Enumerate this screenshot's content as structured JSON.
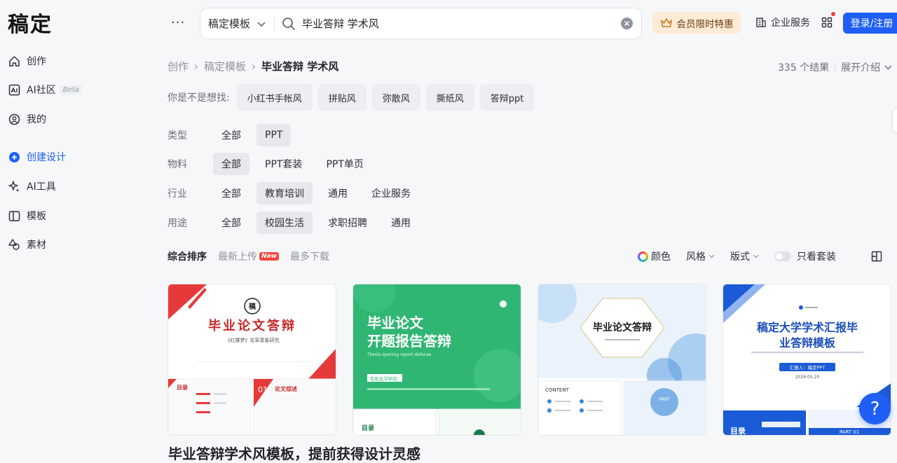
{
  "app": {
    "logo": "稿定"
  },
  "sidebar": {
    "items": [
      {
        "label": "创作",
        "icon": "home-icon"
      },
      {
        "label": "AI社区",
        "icon": "ai-community-icon",
        "badge": "Beta"
      },
      {
        "label": "我的",
        "icon": "user-icon"
      },
      {
        "label": "创建设计",
        "icon": "plus-circle-icon",
        "active": true
      },
      {
        "label": "AI工具",
        "icon": "sparkle-icon"
      },
      {
        "label": "模板",
        "icon": "template-icon"
      },
      {
        "label": "素材",
        "icon": "material-icon"
      }
    ]
  },
  "header": {
    "more": "···",
    "search": {
      "scope": "稿定模板",
      "query": "毕业答辩 学术风"
    },
    "vip": "会员限时特惠",
    "enterprise": "企业服务",
    "login": "登录/注册"
  },
  "breadcrumb": {
    "items": [
      "创作",
      "稿定模板"
    ],
    "current": "毕业答辩 学术风"
  },
  "results": {
    "count": "335 个结果",
    "expand": "展开介绍"
  },
  "suggest": {
    "label": "你是不是想找:",
    "chips": [
      "小红书手帐风",
      "拼贴风",
      "弥散风",
      "撕纸风",
      "答辩ppt"
    ]
  },
  "filters": [
    {
      "label": "类型",
      "options": [
        "全部",
        "PPT"
      ],
      "selected": 1
    },
    {
      "label": "物料",
      "options": [
        "全部",
        "PPT套装",
        "PPT单页"
      ],
      "selected": 0
    },
    {
      "label": "行业",
      "options": [
        "全部",
        "教育培训",
        "通用",
        "企业服务"
      ],
      "selected": 1
    },
    {
      "label": "用途",
      "options": [
        "全部",
        "校园生活",
        "求职招聘",
        "通用"
      ],
      "selected": 1
    }
  ],
  "sort": {
    "options": [
      "综合排序",
      "最新上传",
      "最多下载"
    ],
    "new_badge": "New"
  },
  "right_filters": {
    "color": "颜色",
    "style": "风格",
    "format": "版式",
    "suite_only": "只看套装"
  },
  "cards": [
    {
      "title": "毕业论文答辩",
      "subtitle": "《红楼梦》花草意象研究",
      "toc": "目录",
      "sec": "论文综述",
      "num": "01"
    },
    {
      "title_line1": "毕业论文",
      "title_line2": "开题报告答辩",
      "en": "Thesis opening report defense",
      "tag": "有机化学研究",
      "toc": "目录"
    },
    {
      "title": "毕业论文答辩",
      "content": "CONTENT",
      "part": "PART"
    },
    {
      "title_line1": "稿定大学学术汇报毕",
      "title_line2": "业答辩模板",
      "reporter": "汇报人：稿定PPT",
      "date": "2026.05.20",
      "toc": "目录",
      "part": "PART 01"
    }
  ],
  "footer_text": "毕业答辩学术风模板，提前获得设计灵感"
}
